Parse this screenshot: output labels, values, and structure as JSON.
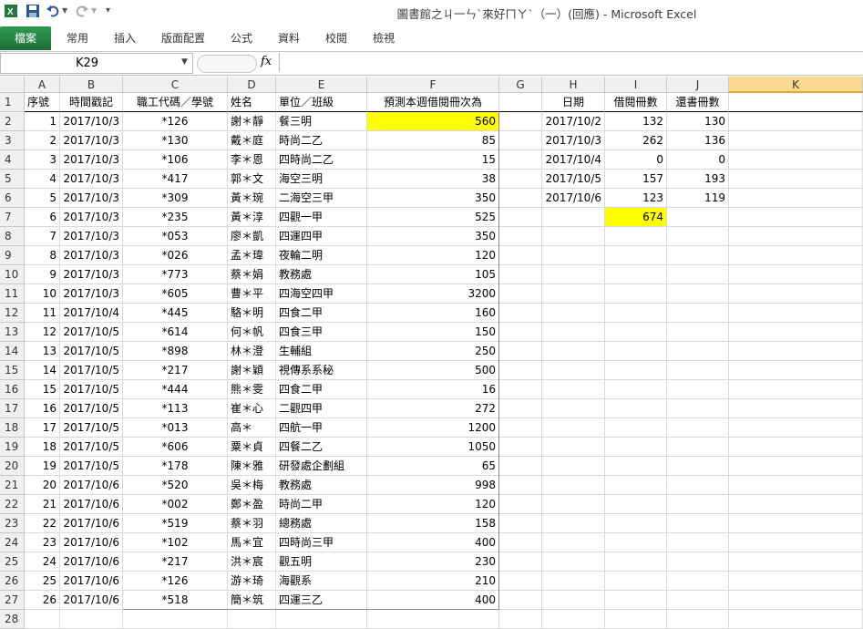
{
  "window": {
    "title": "圖書館之ㄐ一ㄣˋ來好ㄇㄚˋ（一）(回應) - Microsoft Excel"
  },
  "qat": {
    "save_icon": "save-icon",
    "undo_icon": "undo-icon",
    "redo_icon": "redo-icon",
    "customize_icon": "customize-qat-icon"
  },
  "ribbon": {
    "file_tab": "檔案",
    "tabs": [
      "常用",
      "插入",
      "版面配置",
      "公式",
      "資料",
      "校閱",
      "檢視"
    ]
  },
  "formula_bar": {
    "name_box": "K29",
    "fx_label": "fx",
    "formula": ""
  },
  "columns": [
    "A",
    "B",
    "C",
    "D",
    "E",
    "F",
    "G",
    "H",
    "I",
    "J",
    "K"
  ],
  "selected_column": "K",
  "colors": {
    "highlight": "#ffff00",
    "file_tab": "#1f7a3c",
    "selected_header": "#f9d98e"
  },
  "rows": [
    {
      "n": "1",
      "a": "序號",
      "b": "時間戳記",
      "c": "職工代碼／學號",
      "d": "姓名",
      "e": "單位／班級",
      "f": "預測本週借閱冊次為",
      "h": "日期",
      "i": "借閱冊數",
      "j": "還書冊數"
    },
    {
      "n": "2",
      "a": "1",
      "b": "2017/10/3",
      "c": "*126",
      "d": "謝＊靜",
      "e": "餐三明",
      "f": "560",
      "h": "2017/10/2",
      "i": "132",
      "j": "130"
    },
    {
      "n": "3",
      "a": "2",
      "b": "2017/10/3",
      "c": "*130",
      "d": "戴＊庭",
      "e": "時尚二乙",
      "f": "85",
      "h": "2017/10/3",
      "i": "262",
      "j": "136"
    },
    {
      "n": "4",
      "a": "3",
      "b": "2017/10/3",
      "c": "*106",
      "d": "李＊恩",
      "e": "四時尚二乙",
      "f": "15",
      "h": "2017/10/4",
      "i": "0",
      "j": "0"
    },
    {
      "n": "5",
      "a": "4",
      "b": "2017/10/3",
      "c": "*417",
      "d": "郭＊文",
      "e": "海空三明",
      "f": "38",
      "h": "2017/10/5",
      "i": "157",
      "j": "193"
    },
    {
      "n": "6",
      "a": "5",
      "b": "2017/10/3",
      "c": "*309",
      "d": "黃＊琬",
      "e": "二海空三甲",
      "f": "350",
      "h": "2017/10/6",
      "i": "123",
      "j": "119"
    },
    {
      "n": "7",
      "a": "6",
      "b": "2017/10/3",
      "c": "*235",
      "d": "黃＊淳",
      "e": "四觀一甲",
      "f": "525",
      "h": "",
      "i": "674",
      "j": ""
    },
    {
      "n": "8",
      "a": "7",
      "b": "2017/10/3",
      "c": "*053",
      "d": "廖＊凱",
      "e": "四運四甲",
      "f": "350",
      "h": "",
      "i": "",
      "j": ""
    },
    {
      "n": "9",
      "a": "8",
      "b": "2017/10/3",
      "c": "*026",
      "d": "孟＊瑋",
      "e": "夜輪二明",
      "f": "120",
      "h": "",
      "i": "",
      "j": ""
    },
    {
      "n": "10",
      "a": "9",
      "b": "2017/10/3",
      "c": "*773",
      "d": "蔡＊娟",
      "e": "教務處",
      "f": "105",
      "h": "",
      "i": "",
      "j": ""
    },
    {
      "n": "11",
      "a": "10",
      "b": "2017/10/3",
      "c": "*605",
      "d": "曹＊平",
      "e": "四海空四甲",
      "f": "3200",
      "h": "",
      "i": "",
      "j": ""
    },
    {
      "n": "12",
      "a": "11",
      "b": "2017/10/4",
      "c": "*445",
      "d": "駱＊明",
      "e": "四食二甲",
      "f": "160",
      "h": "",
      "i": "",
      "j": ""
    },
    {
      "n": "13",
      "a": "12",
      "b": "2017/10/5",
      "c": "*614",
      "d": "何＊帆",
      "e": "四食三甲",
      "f": "150",
      "h": "",
      "i": "",
      "j": ""
    },
    {
      "n": "14",
      "a": "13",
      "b": "2017/10/5",
      "c": "*898",
      "d": "林＊澄",
      "e": "生輔組",
      "f": "250",
      "h": "",
      "i": "",
      "j": ""
    },
    {
      "n": "15",
      "a": "14",
      "b": "2017/10/5",
      "c": "*217",
      "d": "謝＊穎",
      "e": "視傳系系秘",
      "f": "500",
      "h": "",
      "i": "",
      "j": ""
    },
    {
      "n": "16",
      "a": "15",
      "b": "2017/10/5",
      "c": "*444",
      "d": "熊＊雯",
      "e": "四食二甲",
      "f": "16",
      "h": "",
      "i": "",
      "j": ""
    },
    {
      "n": "17",
      "a": "16",
      "b": "2017/10/5",
      "c": "*113",
      "d": "崔＊心",
      "e": "二觀四甲",
      "f": "272",
      "h": "",
      "i": "",
      "j": ""
    },
    {
      "n": "18",
      "a": "17",
      "b": "2017/10/5",
      "c": "*013",
      "d": "高＊",
      "e": "四航一甲",
      "f": "1200",
      "h": "",
      "i": "",
      "j": ""
    },
    {
      "n": "19",
      "a": "18",
      "b": "2017/10/5",
      "c": "*606",
      "d": "粟＊貞",
      "e": "四餐二乙",
      "f": "1050",
      "h": "",
      "i": "",
      "j": ""
    },
    {
      "n": "20",
      "a": "19",
      "b": "2017/10/5",
      "c": "*178",
      "d": "陳＊雅",
      "e": "研發處企劃組",
      "f": "65",
      "h": "",
      "i": "",
      "j": ""
    },
    {
      "n": "21",
      "a": "20",
      "b": "2017/10/6",
      "c": "*520",
      "d": "吳＊梅",
      "e": "教務處",
      "f": "998",
      "h": "",
      "i": "",
      "j": ""
    },
    {
      "n": "22",
      "a": "21",
      "b": "2017/10/6",
      "c": "*002",
      "d": "鄭＊盈",
      "e": "時尚二甲",
      "f": "120",
      "h": "",
      "i": "",
      "j": ""
    },
    {
      "n": "23",
      "a": "22",
      "b": "2017/10/6",
      "c": "*519",
      "d": "蔡＊羽",
      "e": "總務處",
      "f": "158",
      "h": "",
      "i": "",
      "j": ""
    },
    {
      "n": "24",
      "a": "23",
      "b": "2017/10/6",
      "c": "*102",
      "d": "馬＊宜",
      "e": "四時尚三甲",
      "f": "400",
      "h": "",
      "i": "",
      "j": ""
    },
    {
      "n": "25",
      "a": "24",
      "b": "2017/10/6",
      "c": "*217",
      "d": "洪＊宸",
      "e": "觀五明",
      "f": "230",
      "h": "",
      "i": "",
      "j": ""
    },
    {
      "n": "26",
      "a": "25",
      "b": "2017/10/6",
      "c": "*126",
      "d": "游＊琦",
      "e": "海觀系",
      "f": "210",
      "h": "",
      "i": "",
      "j": ""
    },
    {
      "n": "27",
      "a": "26",
      "b": "2017/10/6",
      "c": "*518",
      "d": "簡＊筑",
      "e": "四運三乙",
      "f": "400",
      "h": "",
      "i": "",
      "j": ""
    },
    {
      "n": "28",
      "a": "",
      "b": "",
      "c": "",
      "d": "",
      "e": "",
      "f": "",
      "h": "",
      "i": "",
      "j": ""
    }
  ]
}
